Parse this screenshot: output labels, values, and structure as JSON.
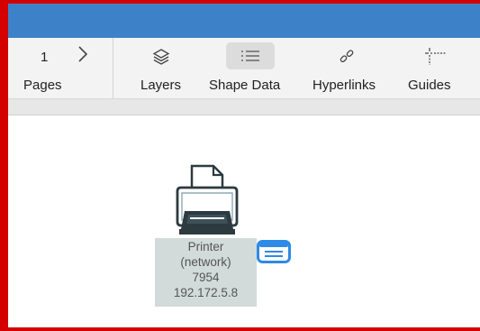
{
  "toolbar": {
    "pages": {
      "number": "1",
      "label": "Pages"
    },
    "layers_label": "Layers",
    "shape_data_label": "Shape Data",
    "hyperlinks_label": "Hyperlinks",
    "guides_label": "Guides"
  },
  "shape": {
    "line1": "Printer",
    "line2": "(network)",
    "line3": "7954",
    "line4": "192.172.5.8"
  },
  "colors": {
    "titlebar": "#3d82c9",
    "frame": "#d40000",
    "shape_label_bg": "#d2dbd9",
    "badge_blue": "#2d8ae6"
  }
}
